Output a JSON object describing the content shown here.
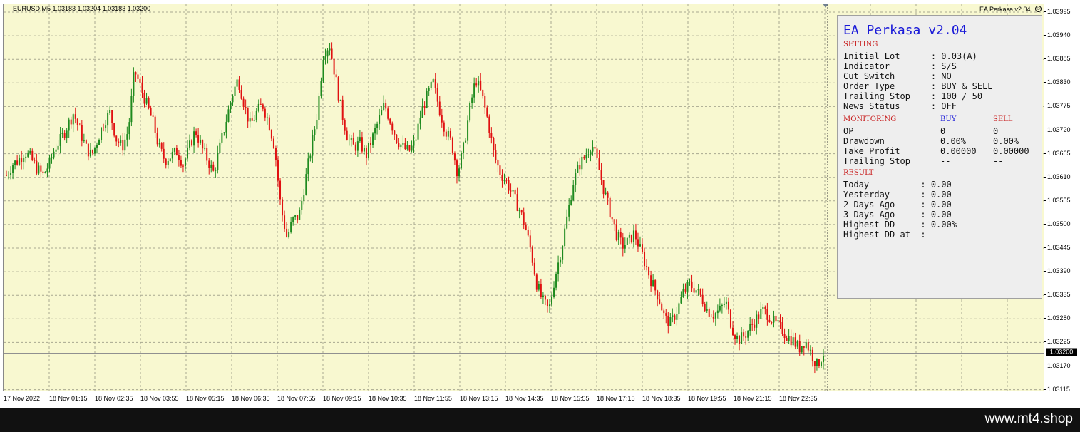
{
  "chart": {
    "symbol_info": "EURUSD,M5  1.03183 1.03204 1.03183 1.03200",
    "ea_label": "EA Perkasa v2.04",
    "smiley_icon": "smiley-icon",
    "current_price": "1.03200",
    "price_ticks": [
      "1.03995",
      "1.03940",
      "1.03885",
      "1.03830",
      "1.03775",
      "1.03720",
      "1.03665",
      "1.03610",
      "1.03555",
      "1.03500",
      "1.03445",
      "1.03390",
      "1.03335",
      "1.03280",
      "1.03225",
      "1.03170",
      "1.03115"
    ],
    "time_ticks": [
      "17 Nov 2022",
      "18 Nov 01:15",
      "18 Nov 02:35",
      "18 Nov 03:55",
      "18 Nov 05:15",
      "18 Nov 06:35",
      "18 Nov 07:55",
      "18 Nov 09:15",
      "18 Nov 10:35",
      "18 Nov 11:55",
      "18 Nov 13:15",
      "18 Nov 14:35",
      "18 Nov 15:55",
      "18 Nov 17:15",
      "18 Nov 18:35",
      "18 Nov 19:55",
      "18 Nov 21:15",
      "18 Nov 22:35"
    ],
    "colors": {
      "background": "#f8f8d0",
      "grid": "#a8a890",
      "bull": "#1e8a1e",
      "bear": "#e01010"
    },
    "close_path": [
      1.03615,
      1.0364,
      1.0365,
      1.0367,
      1.03655,
      1.0363,
      1.03615,
      1.0364,
      1.0368,
      1.037,
      1.0373,
      1.0376,
      1.0372,
      1.0368,
      1.0366,
      1.037,
      1.0374,
      1.0376,
      1.037,
      1.0368,
      1.0372,
      1.0386,
      1.0382,
      1.0378,
      1.0374,
      1.0368,
      1.0365,
      1.0366,
      1.0367,
      1.0364,
      1.0368,
      1.0372,
      1.0368,
      1.0365,
      1.0362,
      1.0368,
      1.0374,
      1.038,
      1.0384,
      1.0378,
      1.0373,
      1.0376,
      1.0378,
      1.0374,
      1.0368,
      1.0354,
      1.0347,
      1.0351,
      1.0352,
      1.036,
      1.0368,
      1.0376,
      1.039,
      1.0392,
      1.0384,
      1.0376,
      1.037,
      1.0368,
      1.0369,
      1.0366,
      1.037,
      1.0374,
      1.0378,
      1.0374,
      1.037,
      1.0368,
      1.0367,
      1.0369,
      1.0376,
      1.038,
      1.0383,
      1.0377,
      1.0372,
      1.0369,
      1.0362,
      1.0368,
      1.0377,
      1.0384,
      1.038,
      1.0374,
      1.0366,
      1.0362,
      1.036,
      1.0357,
      1.0354,
      1.035,
      1.0344,
      1.0336,
      1.0332,
      1.033,
      1.0338,
      1.0344,
      1.0352,
      1.036,
      1.0364,
      1.0366,
      1.0369,
      1.0364,
      1.0358,
      1.0353,
      1.0348,
      1.0345,
      1.0346,
      1.0348,
      1.0344,
      1.034,
      1.0336,
      1.0333,
      1.0328,
      1.0327,
      1.033,
      1.0334,
      1.0336,
      1.0335,
      1.0333,
      1.033,
      1.0329,
      1.033,
      1.0332,
      1.0326,
      1.0323,
      1.0324,
      1.0326,
      1.0328,
      1.033,
      1.0329,
      1.0327,
      1.0326,
      1.0324,
      1.0323,
      1.0321,
      1.0323,
      1.032,
      1.0317,
      1.032
    ]
  },
  "panel": {
    "title": "EA Perkasa v2.04",
    "setting_header": "SETTING",
    "settings": [
      {
        "label": "Initial Lot      ",
        "value": ": 0.03(A)"
      },
      {
        "label": "Indicator        ",
        "value": ": S/S"
      },
      {
        "label": "Cut Switch       ",
        "value": ": NO"
      },
      {
        "label": "Order Type       ",
        "value": ": BUY & SELL"
      },
      {
        "label": "Trailing Stop    ",
        "value": ": 100 / 50"
      },
      {
        "label": "News Status      ",
        "value": ": OFF"
      }
    ],
    "monitoring_header": "MONITORING",
    "buy_header": "BUY",
    "sell_header": "SELL",
    "monitoring": [
      {
        "label": "OP",
        "buy": "0",
        "sell": "0"
      },
      {
        "label": "Drawdown",
        "buy": "0.00%",
        "sell": "0.00%"
      },
      {
        "label": "Take Profit",
        "buy": "0.00000",
        "sell": "0.00000"
      },
      {
        "label": "Trailing Stop",
        "buy": "--",
        "sell": "--"
      }
    ],
    "result_header": "RESULT",
    "results": [
      {
        "label": "Today          ",
        "value": ": 0.00"
      },
      {
        "label": "Yesterday      ",
        "value": ": 0.00"
      },
      {
        "label": "2 Days Ago     ",
        "value": ": 0.00"
      },
      {
        "label": "3 Days Ago     ",
        "value": ": 0.00"
      },
      {
        "label": "Highest DD     ",
        "value": ": 0.00%"
      },
      {
        "label": "Highest DD at  ",
        "value": ": --"
      }
    ]
  },
  "footer": {
    "url": "www.mt4.shop"
  }
}
